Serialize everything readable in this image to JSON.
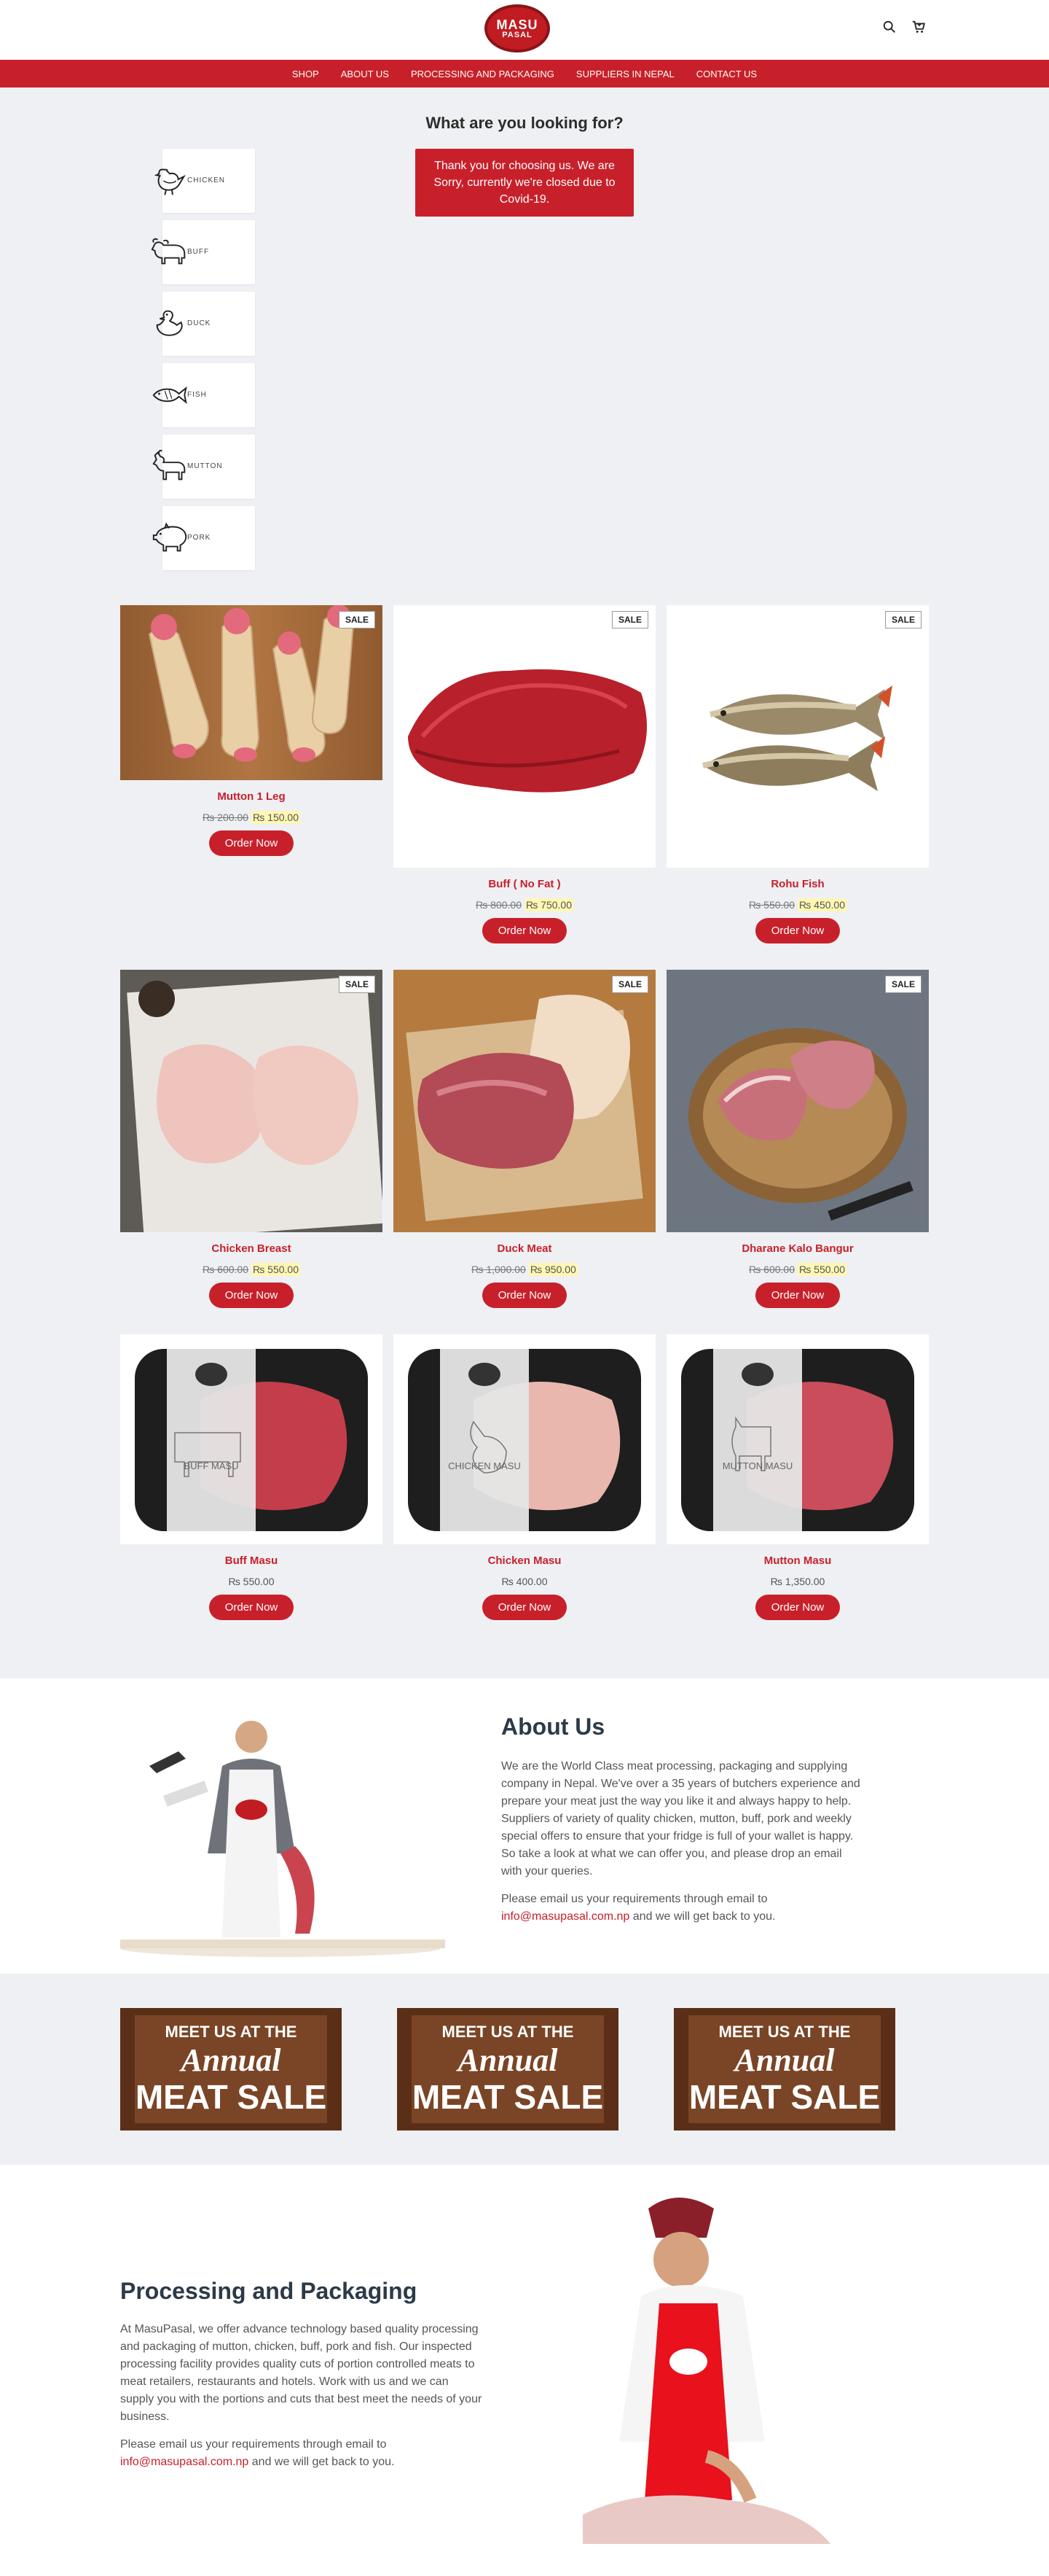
{
  "brand": {
    "line1": "MASU",
    "line2": "PASAL"
  },
  "nav": [
    "SHOP",
    "ABOUT US",
    "PROCESSING AND PACKAGING",
    "SUPPLIERS IN NEPAL",
    "CONTACT US"
  ],
  "heading": "What are you looking for?",
  "notice": "Thank you for choosing us. We are Sorry, currently we're closed due to Covid-19.",
  "categories": [
    "CHICKEN",
    "BUFF",
    "DUCK",
    "FISH",
    "MUTTON",
    "PORK"
  ],
  "sale_label": "SALE",
  "order_label": "Order Now",
  "products": [
    {
      "name": "Mutton 1 Leg",
      "old": "₨ 200.00",
      "price": "₨ 150.00",
      "sale": true
    },
    {
      "name": "Buff ( No Fat )",
      "old": "₨ 800.00",
      "price": "₨ 750.00",
      "sale": true
    },
    {
      "name": "Rohu Fish",
      "old": "₨ 550.00",
      "price": "₨ 450.00",
      "sale": true
    },
    {
      "name": "Chicken Breast",
      "old": "₨ 600.00",
      "price": "₨ 550.00",
      "sale": true
    },
    {
      "name": "Duck Meat",
      "old": "₨ 1,000.00",
      "price": "₨ 950.00",
      "sale": true
    },
    {
      "name": "Dharane Kalo Bangur",
      "old": "₨ 600.00",
      "price": "₨ 550.00",
      "sale": true
    },
    {
      "name": "Buff Masu",
      "old": "",
      "price": "₨ 550.00",
      "sale": false,
      "label": "BUFF MASU"
    },
    {
      "name": "Chicken Masu",
      "old": "",
      "price": "₨ 400.00",
      "sale": false,
      "label": "CHICKEN MASU"
    },
    {
      "name": "Mutton Masu",
      "old": "",
      "price": "₨ 1,350.00",
      "sale": false,
      "label": "MUTTON MASU"
    }
  ],
  "about": {
    "title": "About Us",
    "body": "We are the World Class meat processing, packaging and supplying company in Nepal. We've over a 35 years of butchers experience and prepare your meat just the way you like it and always happy to help. Suppliers of variety of quality chicken, mutton, buff, pork and weekly special offers to ensure that your fridge is full of your wallet is happy. So take a look at what we can offer you, and please drop an email with your queries.",
    "email_intro": "Please email us your requirements through email to",
    "email": "info@masupasal.com.np",
    "email_outro": "and we will get back to you."
  },
  "banner": {
    "line1": "MEET US AT THE",
    "line2": "Annual",
    "line3": "MEAT SALE"
  },
  "processing": {
    "title": "Processing and Packaging",
    "body": "At MasuPasal, we offer advance technology based quality processing and packaging of mutton, chicken, buff, pork and fish. Our inspected processing facility provides quality cuts of portion controlled meats to meat retailers, restaurants and hotels. Work with us and we can supply you with the portions and cuts that best meet the needs of your business.",
    "email_intro": "Please email us your requirements through email to",
    "email": "info@masupasal.com.np",
    "email_outro": "and we will get back to you."
  }
}
